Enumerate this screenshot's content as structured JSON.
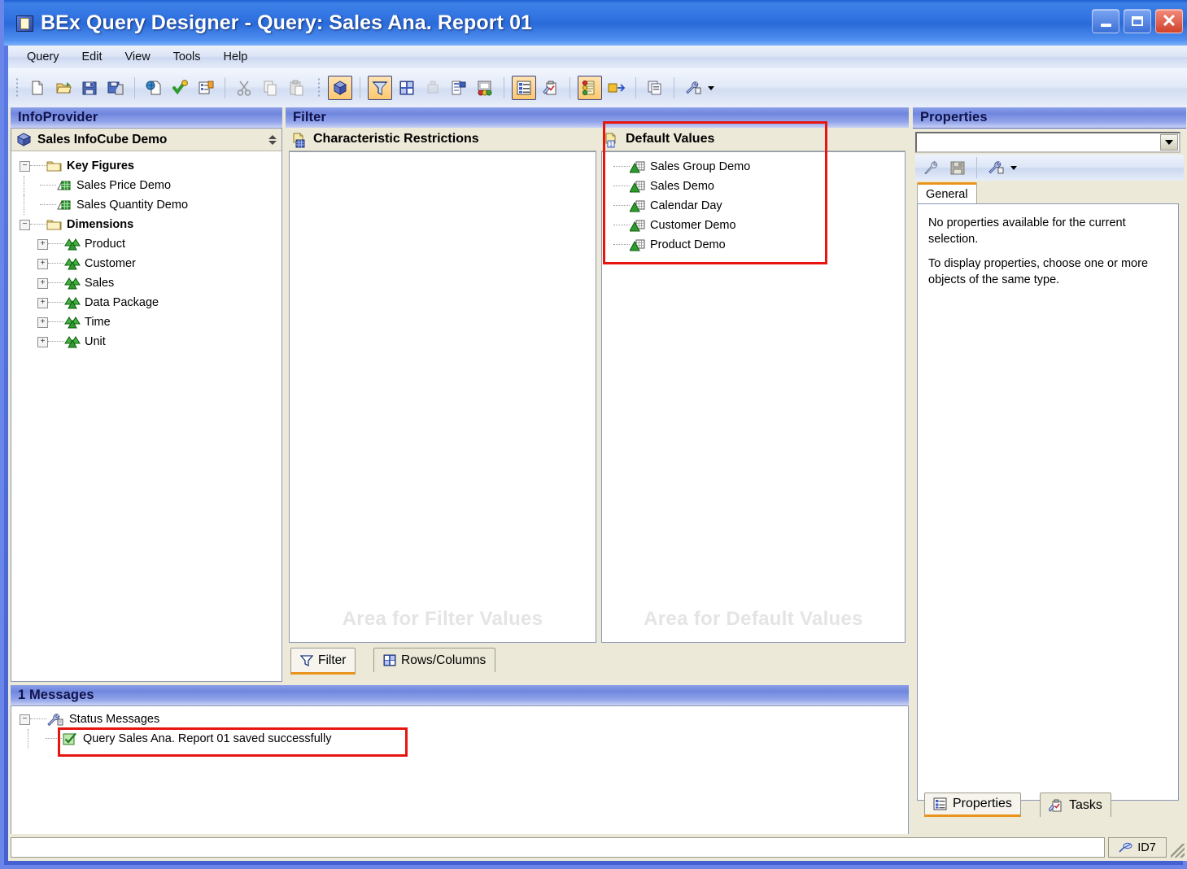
{
  "window": {
    "title": "BEx Query Designer - Query: Sales Ana. Report 01",
    "minimize_label": "Minimize",
    "maximize_label": "Maximize",
    "close_label": "Close"
  },
  "menubar": {
    "items": [
      {
        "label": "Query"
      },
      {
        "label": "Edit"
      },
      {
        "label": "View"
      },
      {
        "label": "Tools"
      },
      {
        "label": "Help"
      }
    ]
  },
  "toolbar": {
    "groups": [
      {
        "buttons": [
          {
            "name": "new-query-icon",
            "label": "New Query",
            "active": false
          },
          {
            "name": "open-query-icon",
            "label": "Open Query",
            "active": false
          },
          {
            "name": "save-query-icon",
            "label": "Save Query",
            "active": false
          },
          {
            "name": "save-as-icon",
            "label": "Save As",
            "active": false
          },
          {
            "name": "publish-icon",
            "label": "Publish",
            "active": false
          },
          {
            "name": "check-query-icon",
            "label": "Check Query",
            "active": false
          },
          {
            "name": "query-properties-icon",
            "label": "Query Properties",
            "active": false
          },
          {
            "name": "cut-icon",
            "label": "Cut",
            "active": false
          },
          {
            "name": "copy-icon",
            "label": "Copy",
            "active": false
          },
          {
            "name": "paste-icon",
            "label": "Paste",
            "active": false
          }
        ]
      },
      {
        "buttons": [
          {
            "name": "infoprovider-icon",
            "label": "InfoProvider",
            "active": true
          },
          {
            "name": "filter-icon",
            "label": "Filter",
            "active": true
          },
          {
            "name": "rows-columns-icon",
            "label": "Rows/Columns",
            "active": false
          },
          {
            "name": "cell-definition-icon",
            "label": "Cell Definition",
            "active": false
          },
          {
            "name": "conditions-icon",
            "label": "Conditions",
            "active": false
          },
          {
            "name": "exceptions-icon",
            "label": "Exceptions",
            "active": false
          },
          {
            "name": "properties-icon",
            "label": "Properties",
            "active": true
          },
          {
            "name": "tasks-icon",
            "label": "Tasks",
            "active": false
          },
          {
            "name": "messages-icon",
            "label": "Messages",
            "active": true
          },
          {
            "name": "where-used-icon",
            "label": "Where-Used List",
            "active": false
          },
          {
            "name": "documents-icon",
            "label": "Documents",
            "active": false
          },
          {
            "name": "settings-icon",
            "label": "Settings",
            "active": false
          }
        ]
      }
    ]
  },
  "infoprovider": {
    "caption": "InfoProvider",
    "cube_name": "Sales InfoCube Demo",
    "tree": [
      {
        "label": "Key Figures",
        "icon": "folder-icon",
        "bold": true,
        "expander": "minus",
        "level": 0
      },
      {
        "label": "Sales Price Demo",
        "icon": "key-figure-icon",
        "bold": false,
        "expander": "none",
        "level": 1
      },
      {
        "label": "Sales Quantity Demo",
        "icon": "key-figure-icon",
        "bold": false,
        "expander": "none",
        "level": 1
      },
      {
        "label": "Dimensions",
        "icon": "folder-icon",
        "bold": true,
        "expander": "minus",
        "level": 0
      },
      {
        "label": "Product",
        "icon": "dimension-icon",
        "bold": false,
        "expander": "plus",
        "level": 1
      },
      {
        "label": "Customer",
        "icon": "dimension-icon",
        "bold": false,
        "expander": "plus",
        "level": 1
      },
      {
        "label": "Sales",
        "icon": "dimension-icon",
        "bold": false,
        "expander": "plus",
        "level": 1
      },
      {
        "label": "Data Package",
        "icon": "dimension-icon",
        "bold": false,
        "expander": "plus",
        "level": 1
      },
      {
        "label": "Time",
        "icon": "dimension-icon",
        "bold": false,
        "expander": "plus",
        "level": 1
      },
      {
        "label": "Unit",
        "icon": "dimension-icon",
        "bold": false,
        "expander": "plus",
        "level": 1
      }
    ]
  },
  "filter": {
    "caption": "Filter",
    "characteristic_restrictions": {
      "title": "Characteristic Restrictions",
      "watermark": "Area for Filter Values",
      "items": []
    },
    "default_values": {
      "title": "Default Values",
      "watermark": "Area for Default Values",
      "highlighted": true,
      "items": [
        {
          "label": "Sales Group Demo",
          "icon": "characteristic-icon"
        },
        {
          "label": "Sales Demo",
          "icon": "characteristic-icon"
        },
        {
          "label": "Calendar Day",
          "icon": "characteristic-icon"
        },
        {
          "label": "Customer Demo",
          "icon": "characteristic-icon"
        },
        {
          "label": "Product Demo",
          "icon": "characteristic-icon"
        }
      ]
    },
    "tabs": [
      {
        "label": "Filter",
        "icon": "filter-tab-icon",
        "active": true
      },
      {
        "label": "Rows/Columns",
        "icon": "rows-columns-tab-icon",
        "active": false
      }
    ]
  },
  "properties": {
    "caption": "Properties",
    "selector_value": "",
    "toolbar": [
      {
        "name": "undo-icon",
        "label": "Undo"
      },
      {
        "name": "save-icon",
        "label": "Save"
      },
      {
        "name": "settings-icon",
        "label": "Settings"
      }
    ],
    "tabs": [
      {
        "label": "General",
        "active": true
      }
    ],
    "body_lines": [
      "No properties available for the current selection.",
      "To display properties, choose one or more objects of the same type."
    ],
    "bottom_tabs": [
      {
        "label": "Properties",
        "icon": "properties-tab-icon",
        "active": true
      },
      {
        "label": "Tasks",
        "icon": "tasks-tab-icon",
        "active": false
      }
    ]
  },
  "messages": {
    "caption": "1 Messages",
    "root": {
      "label": "Status Messages",
      "icon": "wrench-icon",
      "expander": "minus"
    },
    "items": [
      {
        "label": "Query Sales Ana. Report 01 saved successfully",
        "icon": "success-icon",
        "highlighted": true
      }
    ]
  },
  "statusbar": {
    "text": "",
    "system_id": "ID7",
    "system_icon": "connection-icon"
  },
  "colors": {
    "titlebar_blue": "#2f71e0",
    "panel_caption": "#6f86de",
    "highlight_red": "#e8140f",
    "active_tab_orange": "#e8941d",
    "toolbar_active_bg": "#fcc96f",
    "tree_green": "#1f9b2f",
    "folder_yellow": "#f3dd8a",
    "client_bg": "#ece9d8"
  }
}
